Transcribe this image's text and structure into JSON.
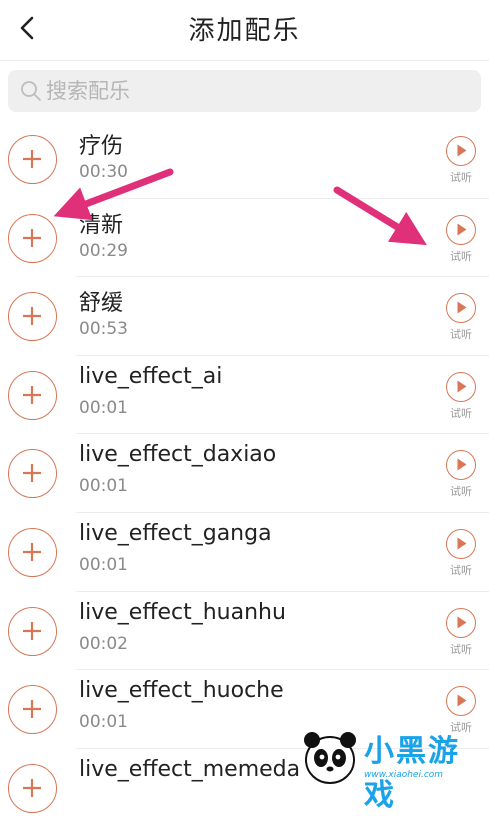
{
  "header": {
    "title": "添加配乐"
  },
  "search": {
    "placeholder": "搜索配乐",
    "value": ""
  },
  "music_list": [
    {
      "name": "疗伤",
      "duration": "00:30",
      "preview_label": "试听"
    },
    {
      "name": "清新",
      "duration": "00:29",
      "preview_label": "试听"
    },
    {
      "name": "舒缓",
      "duration": "00:53",
      "preview_label": "试听"
    },
    {
      "name": "live_effect_ai",
      "duration": "00:01",
      "preview_label": "试听"
    },
    {
      "name": "live_effect_daxiao",
      "duration": "00:01",
      "preview_label": "试听"
    },
    {
      "name": "live_effect_ganga",
      "duration": "00:01",
      "preview_label": "试听"
    },
    {
      "name": "live_effect_huanhu",
      "duration": "00:02",
      "preview_label": "试听"
    },
    {
      "name": "live_effect_huoche",
      "duration": "00:01",
      "preview_label": "试听"
    },
    {
      "name": "live_effect_memeda",
      "duration": "",
      "preview_label": ""
    }
  ],
  "watermark": {
    "brand": "小黑游戏",
    "url": "www.xiaohei.com"
  },
  "colors": {
    "accent": "#d77757",
    "annotation_arrow": "#e0307a",
    "watermark": "#1aa3e8"
  },
  "icons": {
    "back": "chevron-left-icon",
    "search": "search-icon",
    "add": "plus-circle-icon",
    "preview": "play-circle-icon"
  }
}
